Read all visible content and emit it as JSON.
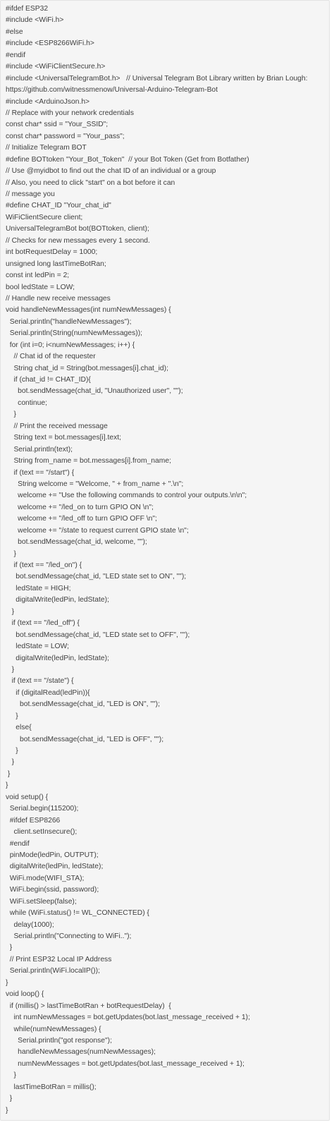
{
  "code": {
    "lines": [
      "#ifdef ESP32",
      "#include <WiFi.h>",
      "#else",
      "#include <ESP8266WiFi.h>",
      "#endif",
      "#include <WiFiClientSecure.h>",
      "#include <UniversalTelegramBot.h>   // Universal Telegram Bot Library written by Brian Lough:",
      "https://github.com/witnessmenow/Universal-Arduino-Telegram-Bot",
      "#include <ArduinoJson.h>",
      "// Replace with your network credentials",
      "const char* ssid = \"Your_SSID\";",
      "const char* password = \"Your_pass\";",
      "// Initialize Telegram BOT",
      "#define BOTtoken \"Your_Bot_Token\"  // your Bot Token (Get from Botfather)",
      "// Use @myidbot to find out the chat ID of an individual or a group",
      "// Also, you need to click \"start\" on a bot before it can",
      "// message you",
      "#define CHAT_ID \"Your_chat_id\"",
      "WiFiClientSecure client;",
      "UniversalTelegramBot bot(BOTtoken, client);",
      "// Checks for new messages every 1 second.",
      "int botRequestDelay = 1000;",
      "unsigned long lastTimeBotRan;",
      "const int ledPin = 2;",
      "bool ledState = LOW;",
      "// Handle new receive messages",
      "void handleNewMessages(int numNewMessages) {",
      "  Serial.println(\"handleNewMessages\");",
      "  Serial.println(String(numNewMessages));",
      "  for (int i=0; i<numNewMessages; i++) {",
      "    // Chat id of the requester",
      "    String chat_id = String(bot.messages[i].chat_id);",
      "    if (chat_id != CHAT_ID){",
      "      bot.sendMessage(chat_id, \"Unauthorized user\", \"\");",
      "      continue;",
      "    }",
      "    // Print the received message",
      "    String text = bot.messages[i].text;",
      "    Serial.println(text);",
      "    String from_name = bot.messages[i].from_name;",
      "    if (text == \"/start\") {",
      "      String welcome = \"Welcome, \" + from_name + \".\\n\";",
      "      welcome += \"Use the following commands to control your outputs.\\n\\n\";",
      "      welcome += \"/led_on to turn GPIO ON \\n\";",
      "      welcome += \"/led_off to turn GPIO OFF \\n\";",
      "      welcome += \"/state to request current GPIO state \\n\";",
      "      bot.sendMessage(chat_id, welcome, \"\");",
      "    }",
      "    if (text == \"/led_on\") {",
      "     bot.sendMessage(chat_id, \"LED state set to ON\", \"\");",
      "     ledState = HIGH;",
      "     digitalWrite(ledPin, ledState);",
      "   }",
      "   if (text == \"/led_off\") {",
      "     bot.sendMessage(chat_id, \"LED state set to OFF\", \"\");",
      "     ledState = LOW;",
      "     digitalWrite(ledPin, ledState);",
      "   }",
      "   if (text == \"/state\") {",
      "     if (digitalRead(ledPin)){",
      "       bot.sendMessage(chat_id, \"LED is ON\", \"\");",
      "     }",
      "     else{",
      "       bot.sendMessage(chat_id, \"LED is OFF\", \"\");",
      "     }",
      "   }",
      " }",
      "}",
      "void setup() {",
      "  Serial.begin(115200);",
      "  #ifdef ESP8266",
      "    client.setInsecure();",
      "  #endif",
      "  pinMode(ledPin, OUTPUT);",
      "  digitalWrite(ledPin, ledState);",
      "  WiFi.mode(WIFI_STA);",
      "  WiFi.begin(ssid, password);",
      "  WiFi.setSleep(false);",
      "  while (WiFi.status() != WL_CONNECTED) {",
      "    delay(1000);",
      "    Serial.println(\"Connecting to WiFi..\");",
      "  }",
      "  // Print ESP32 Local IP Address",
      "  Serial.println(WiFi.localIP());",
      "}",
      "void loop() {",
      "  if (millis() > lastTimeBotRan + botRequestDelay)  {",
      "    int numNewMessages = bot.getUpdates(bot.last_message_received + 1);",
      "    while(numNewMessages) {",
      "      Serial.println(\"got response\");",
      "      handleNewMessages(numNewMessages);",
      "      numNewMessages = bot.getUpdates(bot.last_message_received + 1);",
      "    }",
      "    lastTimeBotRan = millis();",
      "  }",
      "}"
    ]
  }
}
